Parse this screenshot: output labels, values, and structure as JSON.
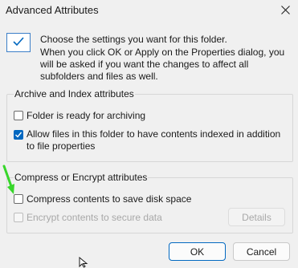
{
  "window": {
    "title": "Advanced Attributes"
  },
  "intro": {
    "heading": "Choose the settings you want for this folder.",
    "detail": "When you click OK or Apply on the Properties dialog, you will be asked if you want the changes to affect all subfolders and files as well."
  },
  "archive_group": {
    "title": "Archive and Index attributes",
    "items": [
      {
        "label": "Folder is ready for archiving",
        "checked": false
      },
      {
        "label": "Allow files in this folder to have contents indexed in addition to file properties",
        "checked": true
      }
    ]
  },
  "compress_group": {
    "title": "Compress or Encrypt attributes",
    "items": [
      {
        "label": "Compress contents to save disk space",
        "checked": false
      },
      {
        "label": "Encrypt contents to secure data",
        "checked": false,
        "disabled": true
      }
    ],
    "details_label": "Details"
  },
  "buttons": {
    "ok": "OK",
    "cancel": "Cancel"
  },
  "colors": {
    "accent": "#0067c0",
    "annotation_arrow": "#37d62a"
  }
}
